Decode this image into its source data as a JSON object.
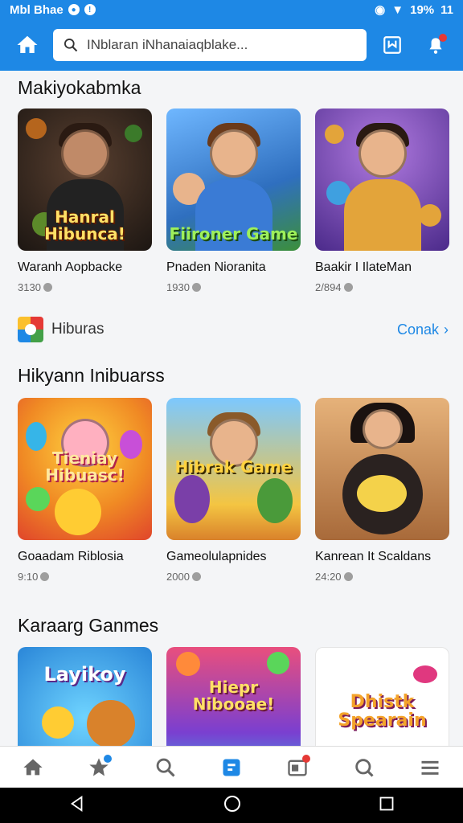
{
  "status_bar": {
    "carrier": "Mbl Bhae",
    "battery": "19%",
    "signal": "11"
  },
  "app_bar": {
    "search_text": "INblaran iNhanaiaqblake..."
  },
  "sections": [
    {
      "title": "Makiyokabmka",
      "cards": [
        {
          "title": "Waranh Aopbacke",
          "meta": "3130",
          "art": "Hanral Hibunca!",
          "bg": "#2b2320",
          "accent": "#c0392b"
        },
        {
          "title": "Pnaden Nioranita",
          "meta": "1930",
          "art": "Fiironer Game",
          "bg": "#3f7fd4",
          "accent": "#8bd65a"
        },
        {
          "title": "Baakir I IlateMan",
          "meta": "2/894",
          "art": "",
          "bg": "#6b3fa8",
          "accent": "#e3a43a"
        }
      ]
    },
    {
      "title": "Hikyann Inibuarss",
      "cards": [
        {
          "title": "Goaadam Riblosia",
          "meta": "9:10",
          "art": "Tieniay Hibuasc!",
          "bg": "#f08a24",
          "accent": "#ff5aa5"
        },
        {
          "title": "Gameolulapnides",
          "meta": "2000",
          "art": "Hibrak Game",
          "bg": "#3fa0e0",
          "accent": "#f4c542"
        },
        {
          "title": "Kanrean It Scaldans",
          "meta": "24:20",
          "art": "",
          "bg": "#c98a4a",
          "accent": "#2a2a2a"
        }
      ]
    },
    {
      "title": "Karaarg Ganmes",
      "cards": [
        {
          "title": "",
          "meta": "",
          "art": "Layikoy",
          "bg": "#35a6e8",
          "accent": "#f08a24"
        },
        {
          "title": "",
          "meta": "",
          "art": "Hiepr Nibooae!",
          "bg": "#e94f7d",
          "accent": "#36b5e8"
        },
        {
          "title": "",
          "meta": "",
          "art": "Dhistk Spearain",
          "bg": "#ffffff",
          "accent": "#e0387f"
        }
      ]
    }
  ],
  "brand": {
    "name": "Hiburas",
    "see_more": "Conak"
  },
  "colors": {
    "primary": "#1e88e5",
    "badge_red": "#e53935"
  }
}
